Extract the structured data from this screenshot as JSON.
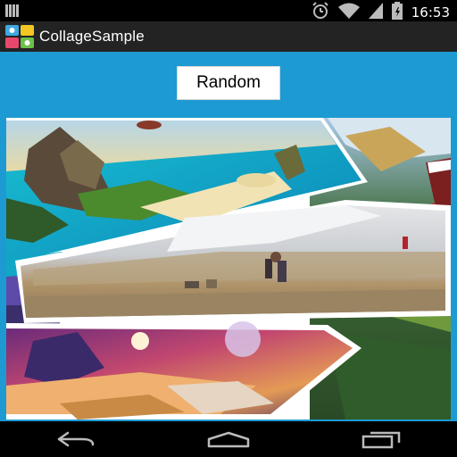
{
  "status_bar": {
    "time": "16:53",
    "icons": [
      "notification-icon",
      "alarm-icon",
      "wifi-icon",
      "cell-signal-icon",
      "battery-icon"
    ]
  },
  "app_bar": {
    "title": "CollageSample",
    "icon": "app-launcher-icon"
  },
  "main": {
    "random_button_label": "Random",
    "background_color": "#1e9ad3",
    "collage": {
      "photos": [
        {
          "name": "fantasy-island-photo"
        },
        {
          "name": "mountain-river-photo"
        },
        {
          "name": "snowy-marsh-family-photo"
        },
        {
          "name": "surreal-planet-landscape-photo"
        },
        {
          "name": "autumn-forest-photo"
        }
      ]
    }
  },
  "nav_bar": {
    "buttons": [
      "back-icon",
      "home-icon",
      "recent-apps-icon"
    ]
  }
}
